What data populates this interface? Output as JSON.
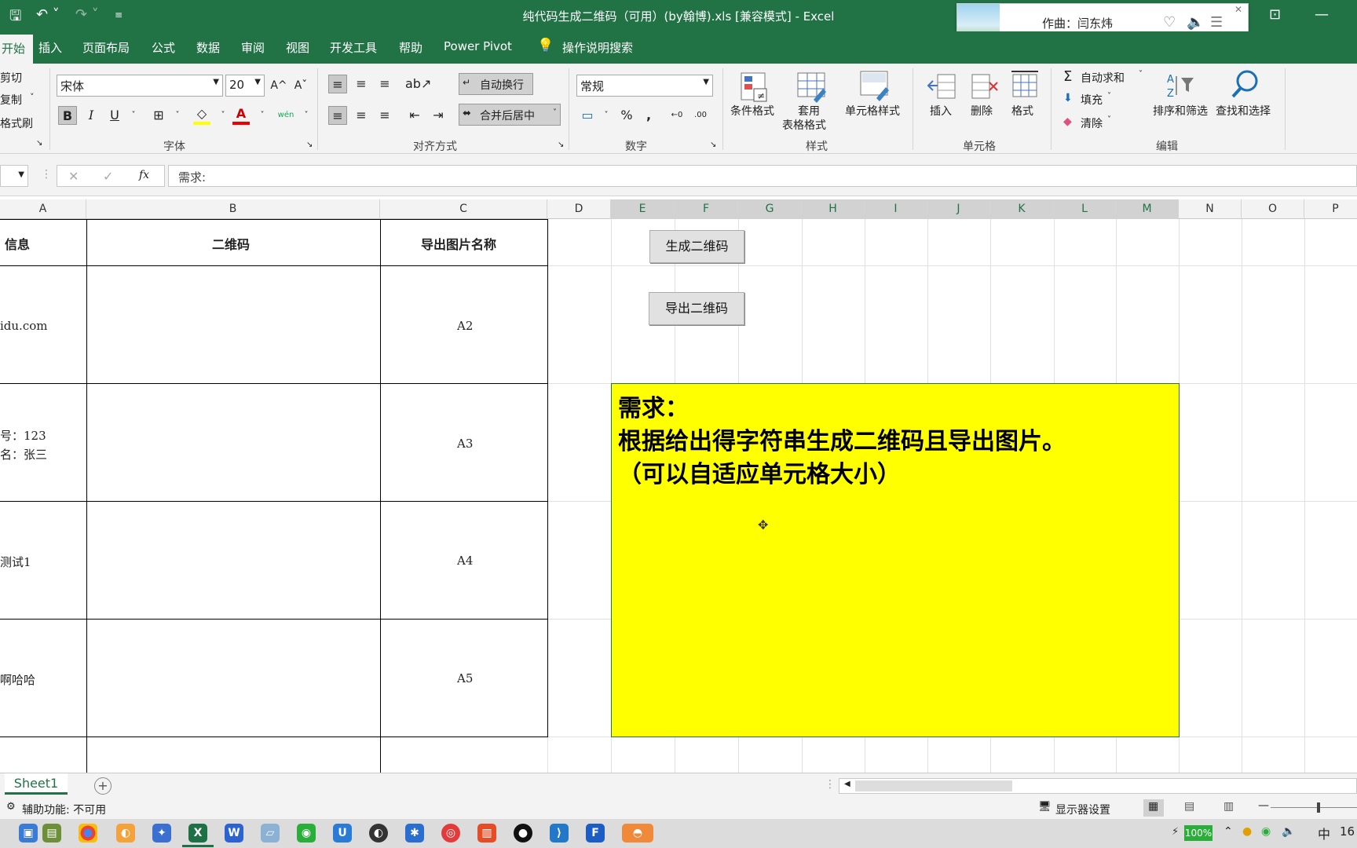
{
  "titlebar": {
    "title": "纯代码生成二维码（可用）(by翰博).xls [兼容模式] - Excel",
    "save": "🖫",
    "undo": "↶ ˅",
    "redo": "↷ ˅",
    "customize": "≡"
  },
  "music": {
    "label": "作曲：闫东炜",
    "close": "✕"
  },
  "tabs": {
    "home": "开始",
    "insert": "插入",
    "layout": "页面布局",
    "formula": "公式",
    "data": "数据",
    "review": "审阅",
    "view": "视图",
    "dev": "开发工具",
    "help": "帮助",
    "pivot": "Power Pivot",
    "tellme": "操作说明搜索"
  },
  "clipboard": {
    "cut": "剪切",
    "copy": "复制",
    "painter": "格式刷"
  },
  "font": {
    "name": "宋体",
    "size": "20",
    "bold": "B",
    "italic": "I",
    "underline": "U",
    "label": "字体",
    "grow": "A^",
    "shrink": "Aˇ",
    "phonetic": "wén"
  },
  "align": {
    "wrap": "自动换行",
    "merge": "合并后居中",
    "label": "对齐方式"
  },
  "number": {
    "format": "常规",
    "percent": "%",
    "comma": ",",
    "label": "数字"
  },
  "styles": {
    "conditional": "条件格式",
    "table_fmt_1": "套用",
    "table_fmt_2": "表格格式",
    "cell_styles": "单元格样式",
    "label": "样式"
  },
  "cells": {
    "insert": "插入",
    "delete": "删除",
    "format": "格式",
    "label": "单元格"
  },
  "editing": {
    "autosum": "自动求和",
    "fill": "填充",
    "clear": "清除",
    "sort": "排序和筛选",
    "find": "查找和选择",
    "label": "编辑"
  },
  "formulabar": {
    "fx": "fx",
    "content": "需求:"
  },
  "columns": [
    "A",
    "B",
    "C",
    "D",
    "E",
    "F",
    "G",
    "H",
    "I",
    "J",
    "K",
    "L",
    "M",
    "N",
    "O",
    "P"
  ],
  "table": {
    "headers": [
      "信息",
      "二维码",
      "导出图片名称"
    ],
    "rows": [
      {
        "a": "idu.com",
        "c": "A2"
      },
      {
        "a1": "号：123",
        "a2": "名：张三",
        "c": "A3"
      },
      {
        "a": "测试1",
        "c": "A4"
      },
      {
        "a": "啊哈哈",
        "c": "A5"
      }
    ]
  },
  "buttons": {
    "generate": "生成二维码",
    "export": "导出二维码"
  },
  "note": {
    "line1": "需求：",
    "line2": "根据给出得字符串生成二维码且导出图片。",
    "line3": "（可以自适应单元格大小）"
  },
  "sheet": {
    "tab": "Sheet1",
    "add": "+"
  },
  "status": {
    "accessibility": "辅助功能: 不可用",
    "display": "显示器设置"
  },
  "taskbar": {
    "battery": "100%",
    "ime": "中",
    "clock": "16"
  }
}
